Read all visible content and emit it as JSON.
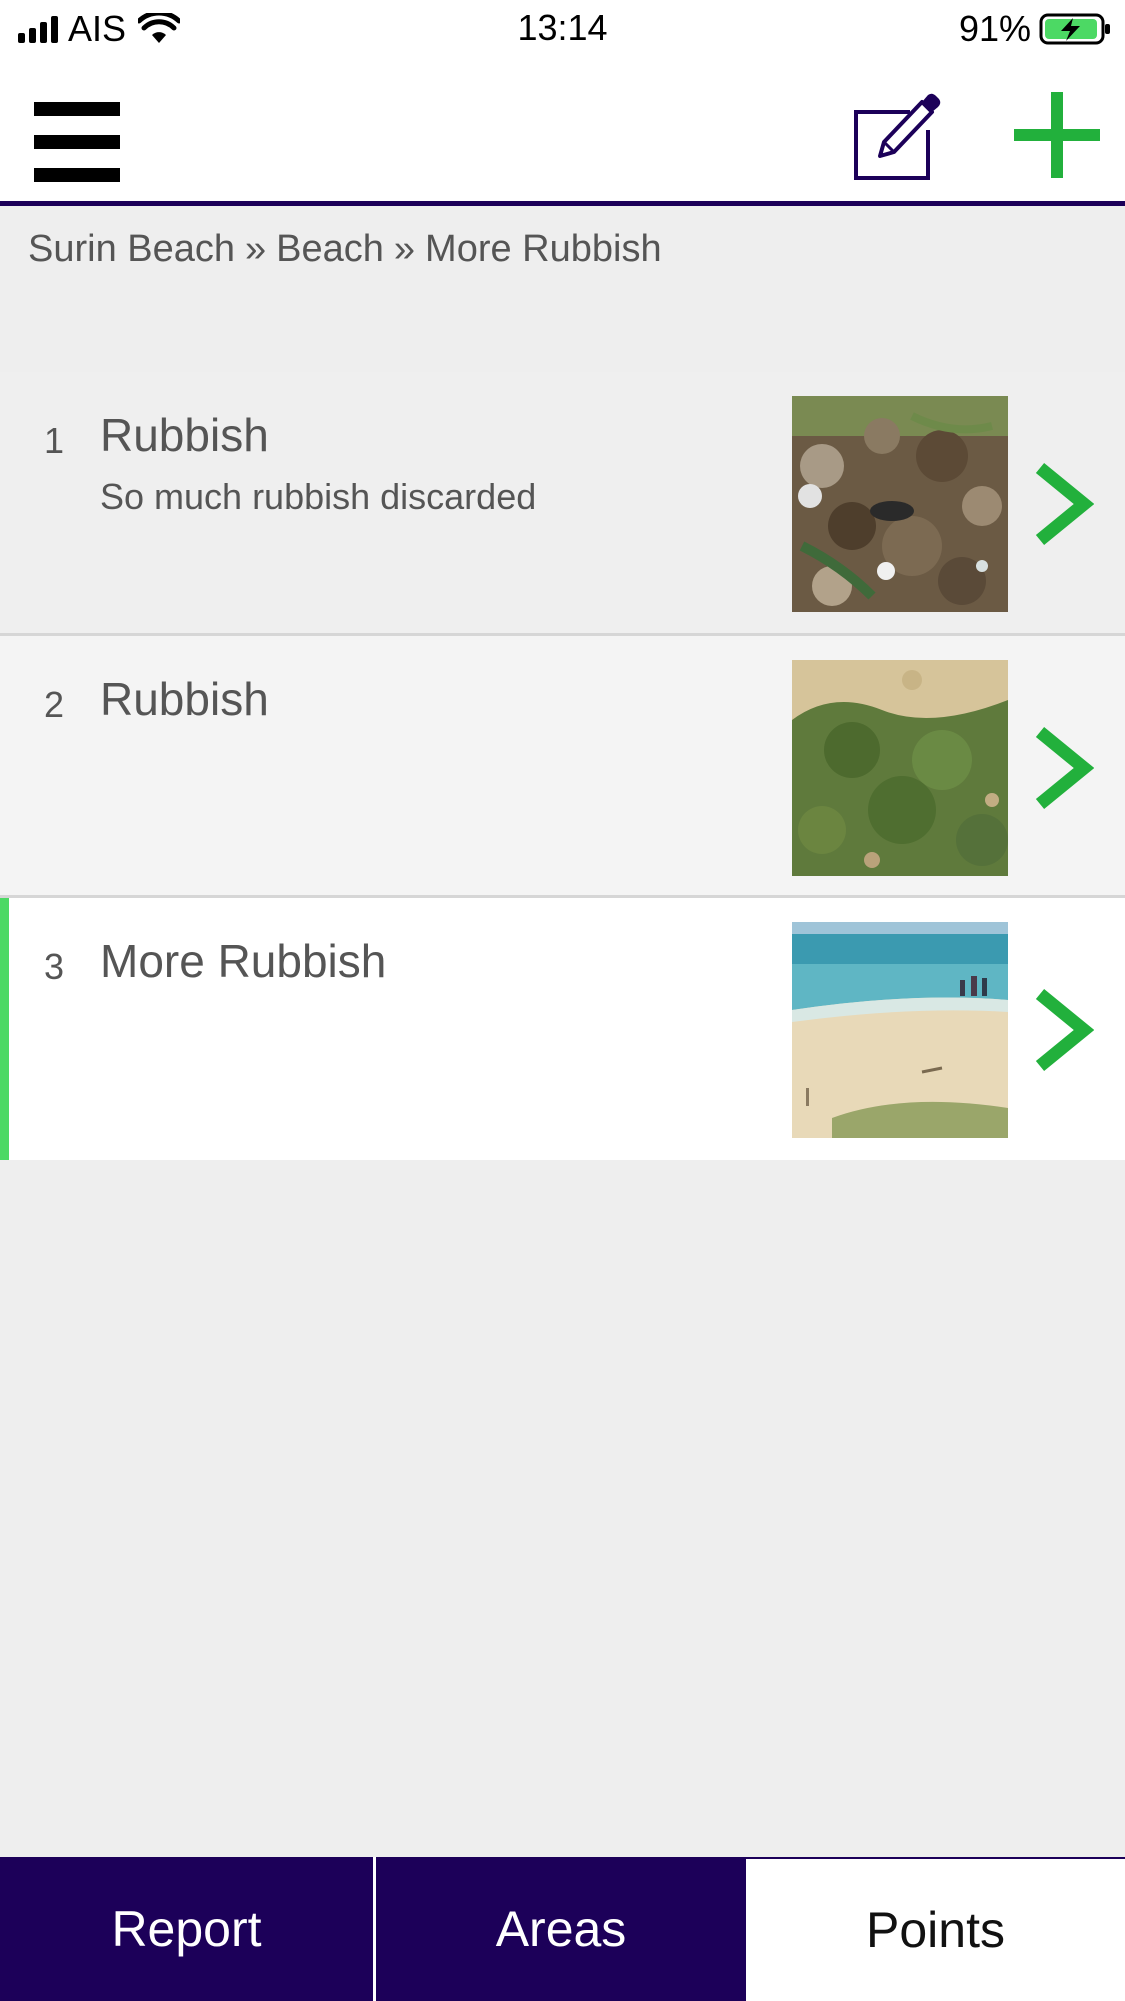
{
  "status_bar": {
    "carrier": "AIS",
    "time": "13:14",
    "battery_percent": "91%"
  },
  "toolbar": {
    "menu_icon": "hamburger-icon",
    "edit_icon": "edit-icon",
    "add_icon": "plus-icon",
    "accent_color": "#1c0059",
    "action_color": "#22b03c"
  },
  "breadcrumb": {
    "items": [
      "Surin Beach",
      "Beach",
      "More Rubbish"
    ],
    "separator": "»"
  },
  "points": [
    {
      "number": "1",
      "title": "Rubbish",
      "subtitle": "So much rubbish discarded",
      "thumbnail": "rubbish-pile-photo"
    },
    {
      "number": "2",
      "title": "Rubbish",
      "subtitle": "",
      "thumbnail": "sand-vegetation-photo"
    },
    {
      "number": "3",
      "title": "More Rubbish",
      "subtitle": "",
      "thumbnail": "beach-sea-photo",
      "selected": true
    }
  ],
  "tabs": {
    "report": "Report",
    "areas": "Areas",
    "points": "Points",
    "active": "Points"
  }
}
